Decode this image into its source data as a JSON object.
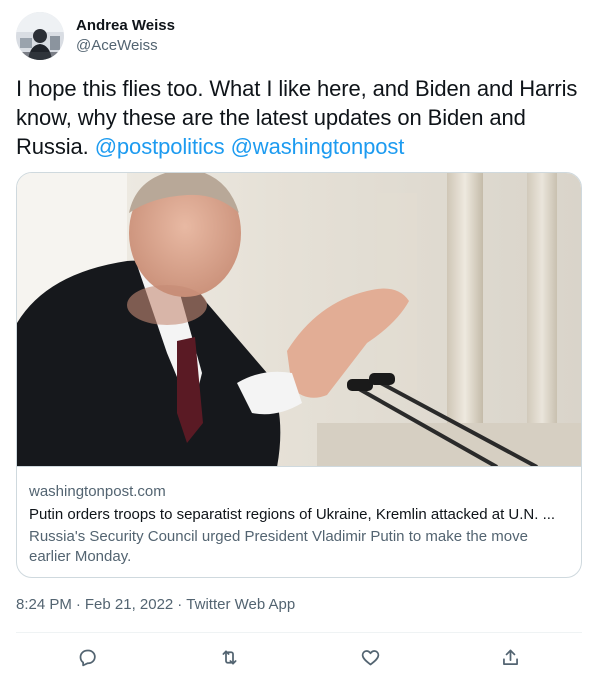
{
  "author": {
    "name": "Andrea Weiss",
    "handle": "@AceWeiss"
  },
  "tweet": {
    "text": "I hope this flies too. What I like here, and Biden and Harris know, why these are the latest updates on Biden and Russia.",
    "mentions": [
      "@postpolitics",
      "@washingtonpost"
    ]
  },
  "card": {
    "domain": "washingtonpost.com",
    "title": "Putin orders troops to separatist regions of Ukraine, Kremlin attacked at U.N. ...",
    "description": "Russia's Security Council urged President Vladimir Putin to make the move earlier Monday."
  },
  "meta": {
    "time": "8:24 PM",
    "date": "Feb 21, 2022",
    "client": "Twitter Web App"
  },
  "colors": {
    "link": "#1d9bf0",
    "secondary_text": "#536471",
    "border": "#cfd9de"
  },
  "icons": {
    "reply": "reply-icon",
    "retweet": "retweet-icon",
    "like": "like-icon",
    "share": "share-icon"
  }
}
